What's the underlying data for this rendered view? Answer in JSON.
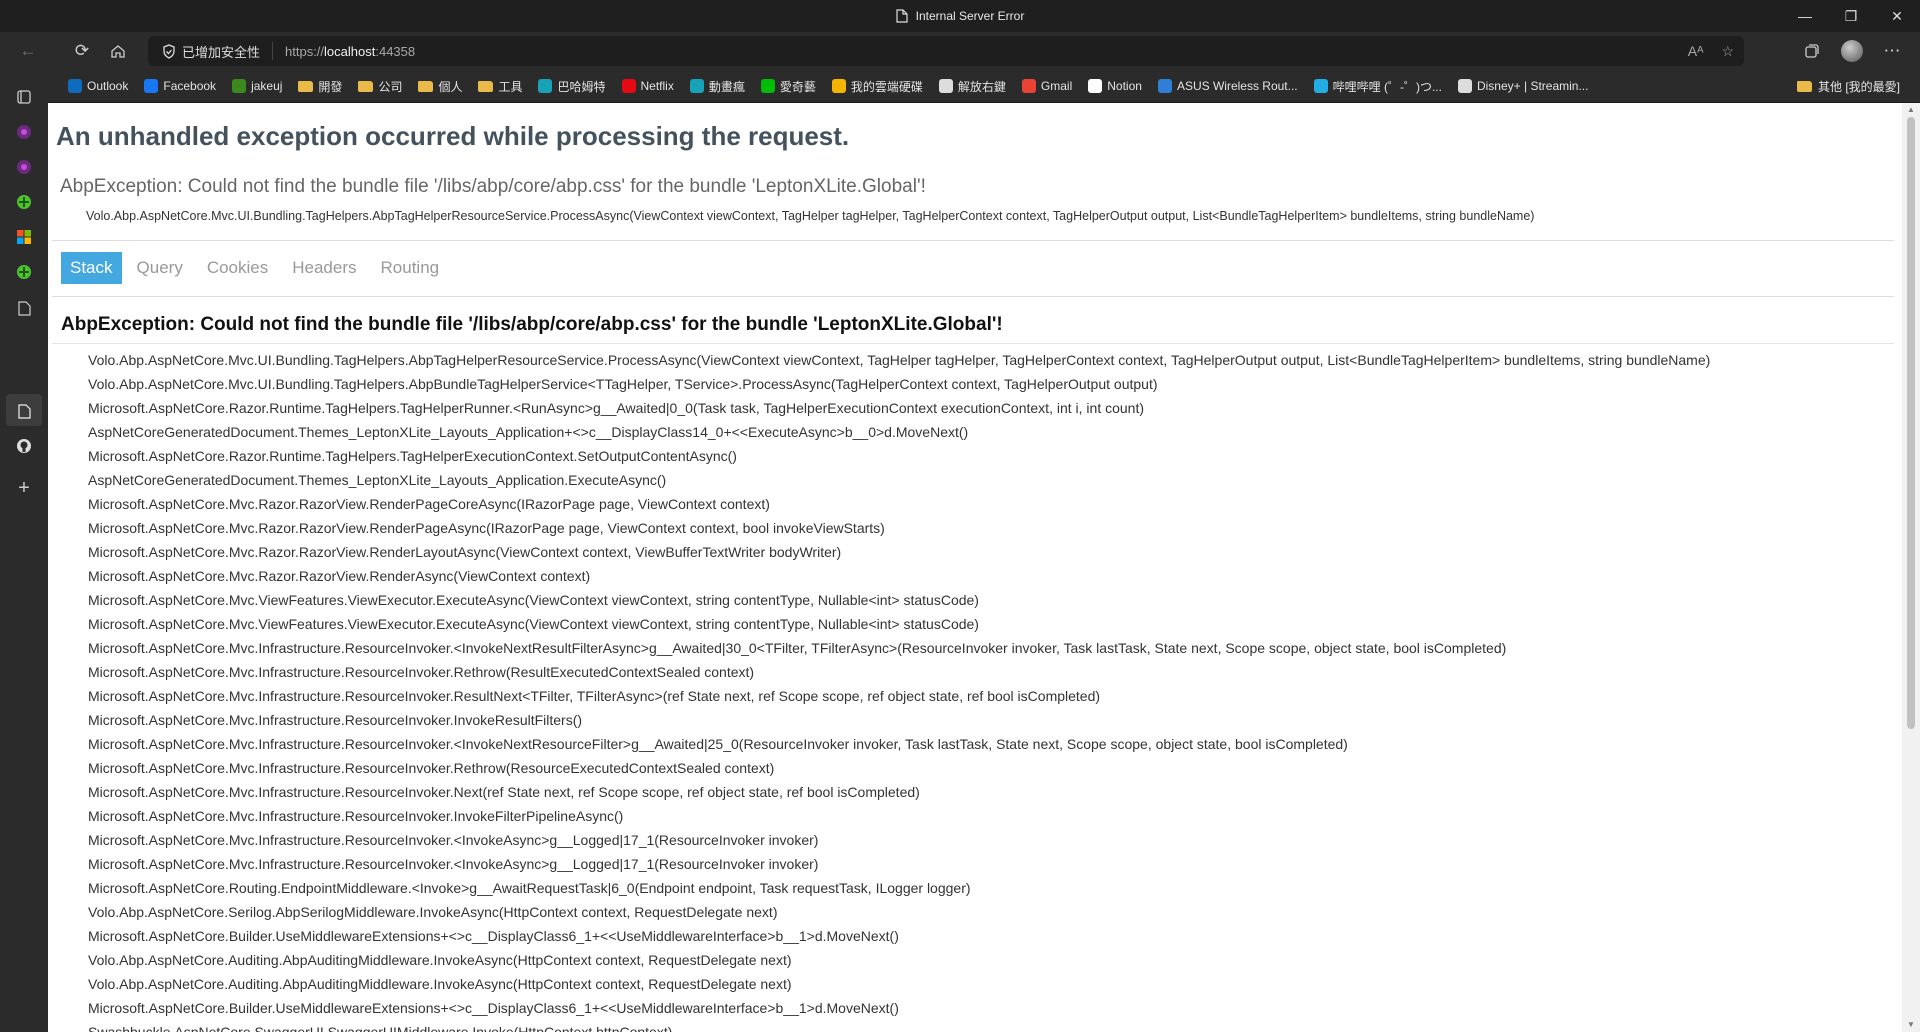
{
  "window": {
    "title": "Internal Server Error",
    "minimize": "—",
    "restore": "❐",
    "close": "✕"
  },
  "address": {
    "security_label": "已增加安全性",
    "url_prefix": "https://",
    "url_host": "localhost",
    "url_port": ":44358"
  },
  "bookmarks": {
    "items": [
      {
        "label": "Outlook",
        "icon": "outlook-icon",
        "color": "#0f6cbd"
      },
      {
        "label": "Facebook",
        "icon": "facebook-icon",
        "color": "#1877f2"
      },
      {
        "label": "jakeuj",
        "icon": "dot-icon",
        "color": "#3c8a1e"
      },
      {
        "label": "開發",
        "icon": "folder-icon",
        "color": "#e9b949"
      },
      {
        "label": "公司",
        "icon": "folder-icon",
        "color": "#e9b949"
      },
      {
        "label": "個人",
        "icon": "folder-icon",
        "color": "#e9b949"
      },
      {
        "label": "工具",
        "icon": "folder-icon",
        "color": "#e9b949"
      },
      {
        "label": "巴哈姆特",
        "icon": "bahamut-icon",
        "color": "#17a2b8"
      },
      {
        "label": "Netflix",
        "icon": "netflix-icon",
        "color": "#e50914"
      },
      {
        "label": "動畫瘋",
        "icon": "ani-icon",
        "color": "#17a2b8"
      },
      {
        "label": "愛奇藝",
        "icon": "iqiyi-icon",
        "color": "#00be06"
      },
      {
        "label": "我的雲端硬碟",
        "icon": "drive-icon",
        "color": "#f4b400"
      },
      {
        "label": "解放右鍵",
        "icon": "page-icon",
        "color": "#dddddd"
      },
      {
        "label": "Gmail",
        "icon": "gmail-icon",
        "color": "#ea4335"
      },
      {
        "label": "Notion",
        "icon": "notion-icon",
        "color": "#ffffff"
      },
      {
        "label": "ASUS Wireless Rout...",
        "icon": "asus-icon",
        "color": "#2f7fd8"
      },
      {
        "label": "哔哩哔哩 (゜-゜)つ...",
        "icon": "bilibili-icon",
        "color": "#23ade5"
      },
      {
        "label": "Disney+ | Streamin...",
        "icon": "page-icon",
        "color": "#dddddd"
      }
    ],
    "other": "其他 [我的最愛]"
  },
  "page": {
    "title": "An unhandled exception occurred while processing the request.",
    "error_message": "AbpException: Could not find the bundle file '/libs/abp/core/abp.css' for the bundle 'LeptonXLite.Global'!",
    "error_location": "Volo.Abp.AspNetCore.Mvc.UI.Bundling.TagHelpers.AbpTagHelperResourceService.ProcessAsync(ViewContext viewContext, TagHelper tagHelper, TagHelperContext context, TagHelperOutput output, List<BundleTagHelperItem> bundleItems, string bundleName)",
    "tabs": [
      "Stack",
      "Query",
      "Cookies",
      "Headers",
      "Routing"
    ],
    "stack_title": "AbpException: Could not find the bundle file '/libs/abp/core/abp.css' for the bundle 'LeptonXLite.Global'!",
    "frames": [
      "Volo.Abp.AspNetCore.Mvc.UI.Bundling.TagHelpers.AbpTagHelperResourceService.ProcessAsync(ViewContext viewContext, TagHelper tagHelper, TagHelperContext context, TagHelperOutput output, List<BundleTagHelperItem> bundleItems, string bundleName)",
      "Volo.Abp.AspNetCore.Mvc.UI.Bundling.TagHelpers.AbpBundleTagHelperService<TTagHelper, TService>.ProcessAsync(TagHelperContext context, TagHelperOutput output)",
      "Microsoft.AspNetCore.Razor.Runtime.TagHelpers.TagHelperRunner.<RunAsync>g__Awaited|0_0(Task task, TagHelperExecutionContext executionContext, int i, int count)",
      "AspNetCoreGeneratedDocument.Themes_LeptonXLite_Layouts_Application+<>c__DisplayClass14_0+<<ExecuteAsync>b__0>d.MoveNext()",
      "Microsoft.AspNetCore.Razor.Runtime.TagHelpers.TagHelperExecutionContext.SetOutputContentAsync()",
      "AspNetCoreGeneratedDocument.Themes_LeptonXLite_Layouts_Application.ExecuteAsync()",
      "Microsoft.AspNetCore.Mvc.Razor.RazorView.RenderPageCoreAsync(IRazorPage page, ViewContext context)",
      "Microsoft.AspNetCore.Mvc.Razor.RazorView.RenderPageAsync(IRazorPage page, ViewContext context, bool invokeViewStarts)",
      "Microsoft.AspNetCore.Mvc.Razor.RazorView.RenderLayoutAsync(ViewContext context, ViewBufferTextWriter bodyWriter)",
      "Microsoft.AspNetCore.Mvc.Razor.RazorView.RenderAsync(ViewContext context)",
      "Microsoft.AspNetCore.Mvc.ViewFeatures.ViewExecutor.ExecuteAsync(ViewContext viewContext, string contentType, Nullable<int> statusCode)",
      "Microsoft.AspNetCore.Mvc.ViewFeatures.ViewExecutor.ExecuteAsync(ViewContext viewContext, string contentType, Nullable<int> statusCode)",
      "Microsoft.AspNetCore.Mvc.Infrastructure.ResourceInvoker.<InvokeNextResultFilterAsync>g__Awaited|30_0<TFilter, TFilterAsync>(ResourceInvoker invoker, Task lastTask, State next, Scope scope, object state, bool isCompleted)",
      "Microsoft.AspNetCore.Mvc.Infrastructure.ResourceInvoker.Rethrow(ResultExecutedContextSealed context)",
      "Microsoft.AspNetCore.Mvc.Infrastructure.ResourceInvoker.ResultNext<TFilter, TFilterAsync>(ref State next, ref Scope scope, ref object state, ref bool isCompleted)",
      "Microsoft.AspNetCore.Mvc.Infrastructure.ResourceInvoker.InvokeResultFilters()",
      "Microsoft.AspNetCore.Mvc.Infrastructure.ResourceInvoker.<InvokeNextResourceFilter>g__Awaited|25_0(ResourceInvoker invoker, Task lastTask, State next, Scope scope, object state, bool isCompleted)",
      "Microsoft.AspNetCore.Mvc.Infrastructure.ResourceInvoker.Rethrow(ResourceExecutedContextSealed context)",
      "Microsoft.AspNetCore.Mvc.Infrastructure.ResourceInvoker.Next(ref State next, ref Scope scope, ref object state, ref bool isCompleted)",
      "Microsoft.AspNetCore.Mvc.Infrastructure.ResourceInvoker.InvokeFilterPipelineAsync()",
      "Microsoft.AspNetCore.Mvc.Infrastructure.ResourceInvoker.<InvokeAsync>g__Logged|17_1(ResourceInvoker invoker)",
      "Microsoft.AspNetCore.Mvc.Infrastructure.ResourceInvoker.<InvokeAsync>g__Logged|17_1(ResourceInvoker invoker)",
      "Microsoft.AspNetCore.Routing.EndpointMiddleware.<Invoke>g__AwaitRequestTask|6_0(Endpoint endpoint, Task requestTask, ILogger logger)",
      "Volo.Abp.AspNetCore.Serilog.AbpSerilogMiddleware.InvokeAsync(HttpContext context, RequestDelegate next)",
      "Microsoft.AspNetCore.Builder.UseMiddlewareExtensions+<>c__DisplayClass6_1+<<UseMiddlewareInterface>b__1>d.MoveNext()",
      "Volo.Abp.AspNetCore.Auditing.AbpAuditingMiddleware.InvokeAsync(HttpContext context, RequestDelegate next)",
      "Volo.Abp.AspNetCore.Auditing.AbpAuditingMiddleware.InvokeAsync(HttpContext context, RequestDelegate next)",
      "Microsoft.AspNetCore.Builder.UseMiddlewareExtensions+<>c__DisplayClass6_1+<<UseMiddlewareInterface>b__1>d.MoveNext()",
      "Swashbuckle.AspNetCore.SwaggerUI.SwaggerUIMiddleware.Invoke(HttpContext httpContext)"
    ]
  },
  "colors": {
    "tab_active": "#44a8e0",
    "title": "#44525e"
  }
}
